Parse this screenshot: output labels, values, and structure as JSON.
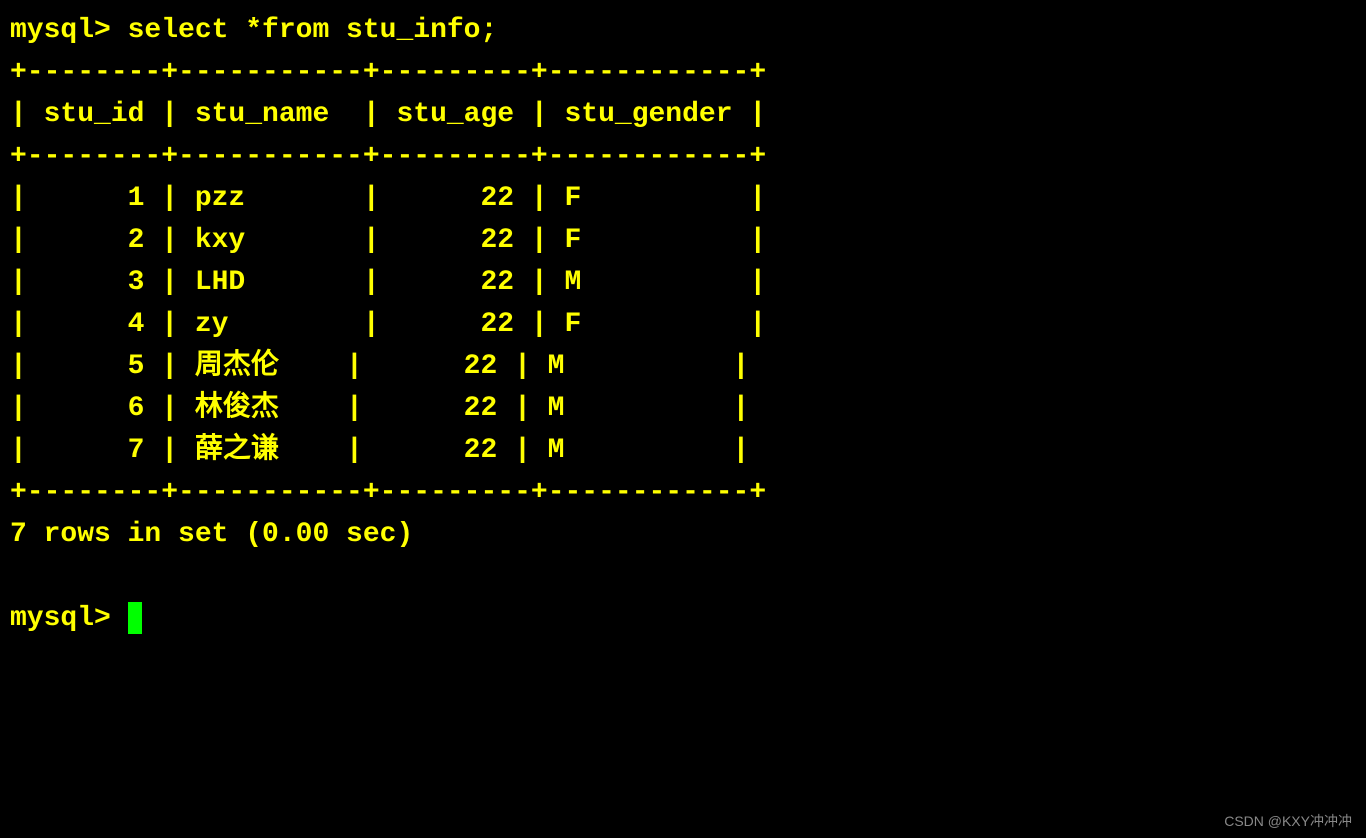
{
  "prompt1": "mysql> ",
  "query": "select *from stu_info;",
  "columns": [
    "stu_id",
    "stu_name",
    "stu_age",
    "stu_gender"
  ],
  "rows": [
    {
      "stu_id": 1,
      "stu_name": "pzz",
      "stu_age": 22,
      "stu_gender": "F"
    },
    {
      "stu_id": 2,
      "stu_name": "kxy",
      "stu_age": 22,
      "stu_gender": "F"
    },
    {
      "stu_id": 3,
      "stu_name": "LHD",
      "stu_age": 22,
      "stu_gender": "M"
    },
    {
      "stu_id": 4,
      "stu_name": "zy",
      "stu_age": 22,
      "stu_gender": "F"
    },
    {
      "stu_id": 5,
      "stu_name": "周杰伦",
      "stu_age": 22,
      "stu_gender": "M"
    },
    {
      "stu_id": 6,
      "stu_name": "林俊杰",
      "stu_age": 22,
      "stu_gender": "M"
    },
    {
      "stu_id": 7,
      "stu_name": "薛之谦",
      "stu_age": 22,
      "stu_gender": "M"
    }
  ],
  "status": "7 rows in set (0.00 sec)",
  "prompt2": "mysql> ",
  "watermark": "CSDN @KXY冲冲冲",
  "col_widths": {
    "stu_id": 8,
    "stu_name": 11,
    "stu_age": 9,
    "stu_gender": 12
  }
}
